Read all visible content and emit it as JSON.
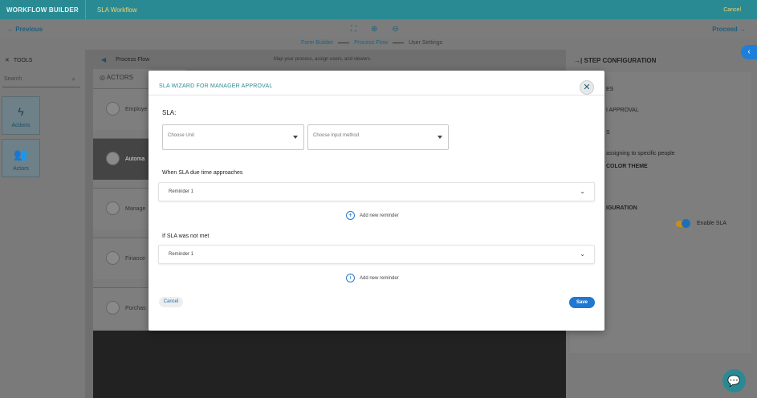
{
  "topbar": {
    "brand": "WORKFLOW BUILDER",
    "workflow_name": "SLA Workflow",
    "cancel": "Cancel"
  },
  "nav": {
    "previous": "← Previous",
    "next": "Proceed →"
  },
  "steps": [
    "Form Builder",
    "Process Flow",
    "User Settings"
  ],
  "tools": {
    "header": "TOOLS",
    "search_placeholder": "Search",
    "tiles": [
      {
        "label": "Actions",
        "icon": "lightning-icon"
      },
      {
        "label": "Actors",
        "icon": "users-icon"
      }
    ]
  },
  "canvas": {
    "title": "Process Flow",
    "hint": "Map your process, assign users, and viewers.",
    "actors_header": "ACTORS",
    "actors": [
      "Employe",
      "Automa",
      "Manage",
      "Finance",
      "Purchas"
    ]
  },
  "config": {
    "header": "STEP CONFIGURATION",
    "partial_labels": [
      "ES",
      "I APPROVAL",
      "S",
      "assigning to specific people",
      "COLOR THEME",
      "IGURATION"
    ],
    "enable_sla": "Enable SLA"
  },
  "modal": {
    "title": "SLA WIZARD FOR MANAGER APPROVAL",
    "sla_label": "SLA:",
    "choose_unit": "Choose Unit",
    "choose_input": "Choose input method",
    "approach_label": "When SLA due time approaches",
    "not_met_label": "If SLA was not met",
    "reminder_1": "Reminder 1",
    "reminder_2": "Reminder 1",
    "add_reminder_1": "Add new reminder",
    "add_reminder_2": "Add new reminder",
    "cancel": "Cancel",
    "save": "Save"
  }
}
